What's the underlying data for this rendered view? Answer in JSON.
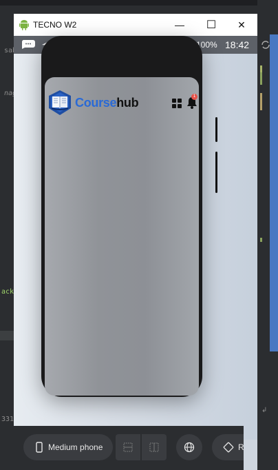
{
  "ide": {
    "fragments": [
      "sab",
      "nag",
      "ack",
      "331"
    ]
  },
  "window": {
    "title": "TECNO W2",
    "controls": {
      "minimize": "—",
      "maximize": "☐",
      "close": "✕"
    }
  },
  "statusbar": {
    "battery": "100%",
    "time": "18:42"
  },
  "app": {
    "brand_part1": "Course",
    "brand_part2": "hub",
    "notification_badge": "1",
    "colors": {
      "brand_blue": "#2a6ad6",
      "badge_red": "#e5534b"
    }
  },
  "toolbar": {
    "device_label": "Medium phone",
    "rotate_label": "Rotat"
  }
}
